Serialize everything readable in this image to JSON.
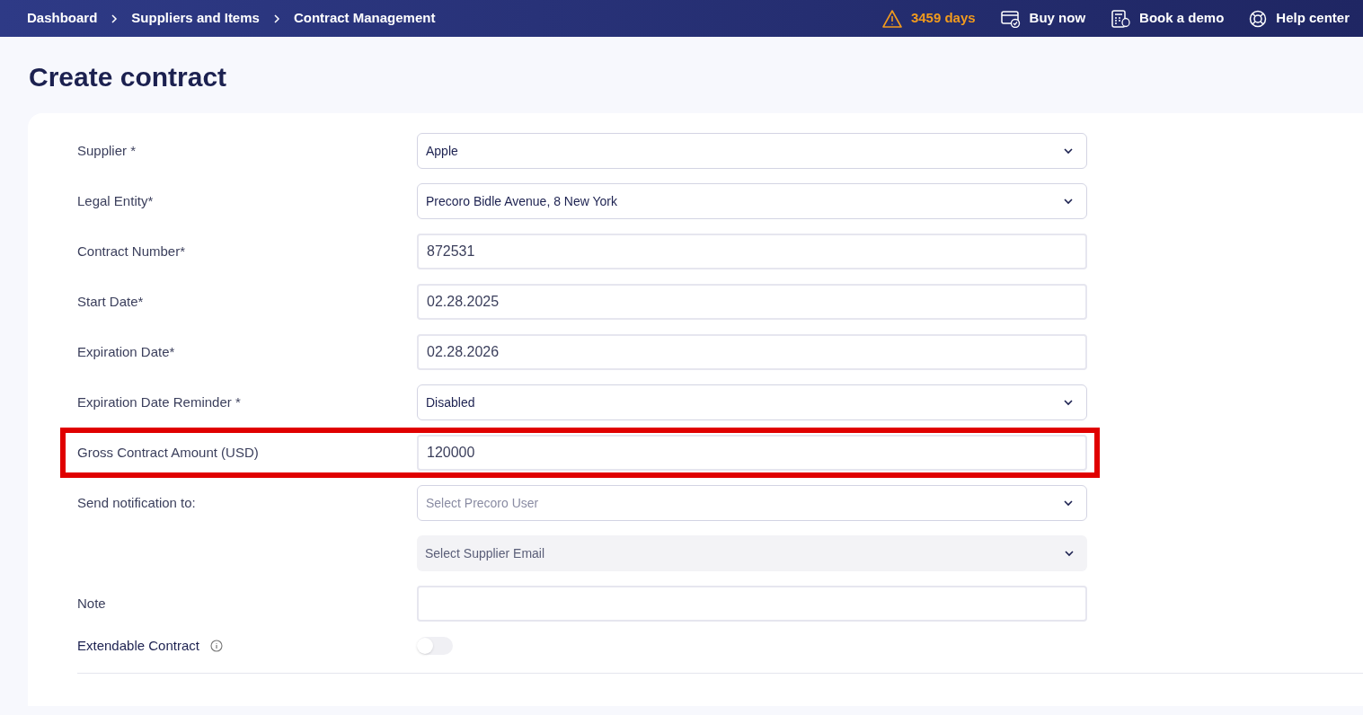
{
  "breadcrumbs": [
    "Dashboard",
    "Suppliers and Items",
    "Contract Management"
  ],
  "header_links": [
    {
      "kind": "trial",
      "label": "3459 days"
    },
    {
      "kind": "buy",
      "label": "Buy now"
    },
    {
      "kind": "demo",
      "label": "Book a demo"
    },
    {
      "kind": "help",
      "label": "Help center"
    }
  ],
  "page_title": "Create contract",
  "form_rows": [
    {
      "label": "Supplier *",
      "kind": "select",
      "value": "Apple",
      "highlighted": false
    },
    {
      "label": "Legal Entity*",
      "kind": "select",
      "value": "Precoro Bidle Avenue, 8 New York",
      "highlighted": false
    },
    {
      "label": "Contract Number*",
      "kind": "input",
      "value": "872531",
      "highlighted": false
    },
    {
      "label": "Start Date*",
      "kind": "input",
      "value": "02.28.2025",
      "highlighted": false
    },
    {
      "label": "Expiration Date*",
      "kind": "input",
      "value": "02.28.2026",
      "highlighted": false
    },
    {
      "label": "Expiration Date Reminder *",
      "kind": "select",
      "value": "Disabled",
      "highlighted": false
    },
    {
      "label": "Gross Contract Amount (USD)",
      "kind": "input",
      "value": "120000",
      "highlighted": true
    },
    {
      "label": "Send notification to:",
      "kind": "select",
      "placeholder": "Select Precoro User",
      "highlighted": false
    },
    {
      "kind": "select_disabled",
      "placeholder": "Select Supplier Email",
      "highlighted": false
    },
    {
      "label": "Note",
      "kind": "input",
      "highlighted": false
    },
    {
      "label": "Extendable Contract",
      "kind": "toggle",
      "on": false,
      "highlighted": false
    }
  ]
}
